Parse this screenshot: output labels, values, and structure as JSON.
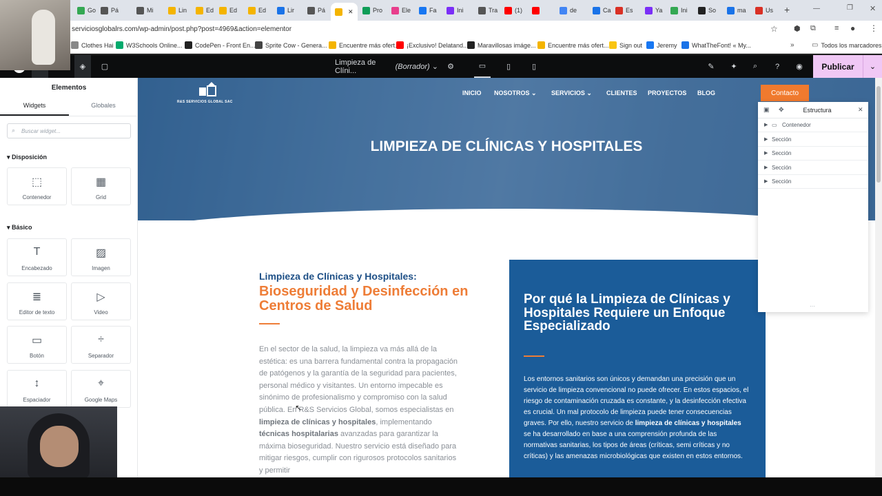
{
  "browser": {
    "tabs": [
      {
        "label": "Go",
        "color": "#34a853"
      },
      {
        "label": "Pá",
        "color": "#555555"
      },
      {
        "label": "Mi",
        "color": "#555555"
      },
      {
        "label": "Lin",
        "color": "#f4b400"
      },
      {
        "label": "Ed",
        "color": "#f4b400"
      },
      {
        "label": "Ed",
        "color": "#f4b400"
      },
      {
        "label": "Ed",
        "color": "#f4b400"
      },
      {
        "label": "Lir",
        "color": "#1a73e8"
      },
      {
        "label": "Pá",
        "color": "#555555"
      },
      {
        "label": "",
        "color": "#f4b400"
      },
      {
        "label": "Pro",
        "color": "#0f9d58"
      },
      {
        "label": "Ele",
        "color": "#e83e8c"
      },
      {
        "label": "Fa",
        "color": "#1877f2"
      },
      {
        "label": "Ini",
        "color": "#7b2ff7"
      },
      {
        "label": "Tra",
        "color": "#555555"
      },
      {
        "label": "(1)",
        "color": "#ff0000"
      },
      {
        "label": "",
        "color": "#ff0000"
      },
      {
        "label": "de",
        "color": "#4285f4"
      },
      {
        "label": "Ca",
        "color": "#1a73e8"
      },
      {
        "label": "Es",
        "color": "#d93025"
      },
      {
        "label": "Ya",
        "color": "#7b2ff7"
      },
      {
        "label": "Ini",
        "color": "#34a853"
      },
      {
        "label": "So",
        "color": "#222222"
      },
      {
        "label": "ma",
        "color": "#1a73e8"
      },
      {
        "label": "Us",
        "color": "#d93025"
      }
    ],
    "url": "serviciosglobalrs.com/wp-admin/post.php?post=4969&action=elementor",
    "bookmarks": [
      {
        "label": "Clothes Hai",
        "color": "#888888"
      },
      {
        "label": "W3Schools Online...",
        "color": "#04aa6d"
      },
      {
        "label": "CodePen - Front En...",
        "color": "#222222"
      },
      {
        "label": "Sprite Cow - Genera...",
        "color": "#444444"
      },
      {
        "label": "Encuentre más ofert...",
        "color": "#f4b400"
      },
      {
        "label": "¡Exclusivo! Delatand...",
        "color": "#ff0000"
      },
      {
        "label": "Maravillosas imáge...",
        "color": "#222222"
      },
      {
        "label": "Encuentre más ofert...",
        "color": "#f4b400"
      },
      {
        "label": "Sign out",
        "color": "#f9c513"
      },
      {
        "label": "Jeremy",
        "color": "#1877f2"
      },
      {
        "label": "WhatTheFont! « My...",
        "color": "#1a73e8"
      }
    ],
    "all_bookmarks": "Todos los marcadores"
  },
  "elementor_bar": {
    "doc_title": "Limpieza de Clíni...",
    "doc_status": "(Borrador)",
    "publish_label": "Publicar",
    "accent": "#f0c8f5"
  },
  "panel": {
    "title": "Elementos",
    "tabs": [
      "Widgets",
      "Globales"
    ],
    "search_placeholder": "Buscar widget...",
    "categories": {
      "layout": "Disposición",
      "basic": "Básico"
    },
    "layout_widgets": [
      {
        "label": "Contenedor",
        "icon": "container-icon"
      },
      {
        "label": "Grid",
        "icon": "grid-icon"
      }
    ],
    "basic_widgets": [
      {
        "label": "Encabezado",
        "icon": "heading-icon"
      },
      {
        "label": "Imagen",
        "icon": "image-icon"
      },
      {
        "label": "Editor de texto",
        "icon": "text-editor-icon"
      },
      {
        "label": "Video",
        "icon": "video-icon"
      },
      {
        "label": "Botón",
        "icon": "button-icon"
      },
      {
        "label": "Separador",
        "icon": "divider-icon"
      },
      {
        "label": "Espaciador",
        "icon": "spacer-icon"
      },
      {
        "label": "Google Maps",
        "icon": "map-icon"
      }
    ]
  },
  "site": {
    "logo_text": "R&S SERVICIOS GLOBAL SAC",
    "nav": [
      "INICIO",
      "NOSOTROS",
      "SERVICIOS",
      "CLIENTES",
      "PROYECTOS",
      "BLOG"
    ],
    "contact_label": "Contacto",
    "hero_title": "LIMPIEZA DE CLÍNICAS Y HOSPITALES",
    "sub_heading": "Limpieza de Clínicas y Hospitales:",
    "main_heading": "Bioseguridad y Desinfección en Centros de Salud",
    "body_parts": [
      "En el sector de la salud, la limpieza va más allá de la estética: es una barrera fundamental contra la propagación de patógenos y la garantía de la seguridad para pacientes, personal médico y visitantes. Un entorno impecable es sinónimo de profesionalismo y compromiso con la salud pública. En R&S Servicios Global, somos especialistas en ",
      "limpieza de clínicas y hospitales",
      ", implementando ",
      "técnicas hospitalarias",
      " avanzadas para garantizar la máxima bioseguridad. Nuestro servicio está diseñado para mitigar riesgos, cumplir con rigurosos protocolos sanitarios y permitir"
    ],
    "box_title": "Por qué la Limpieza de Clínicas y Hospitales Requiere un Enfoque Especializado",
    "box_parts": [
      "Los entornos sanitarios son únicos y demandan una precisión que un servicio de limpieza convencional no puede ofrecer. En estos espacios, el riesgo de contaminación cruzada es constante, y la desinfección efectiva es crucial. Un mal protocolo de limpieza puede tener consecuencias graves. Por ello, nuestro servicio de ",
      "limpieza de clínicas y hospitales",
      " se ha desarrollado en base a una comprensión profunda de las normativas sanitarias, los tipos de áreas (críticas, semi críticas y no críticas) y las amenazas microbiológicas que existen en estos entornos."
    ],
    "colors": {
      "blue": "#1b5c99",
      "orange": "#ee7d37",
      "navy": "#1d4f86"
    }
  },
  "structure": {
    "title": "Estructura",
    "items": [
      "Contenedor",
      "Sección",
      "Sección",
      "Sección",
      "Sección"
    ]
  }
}
